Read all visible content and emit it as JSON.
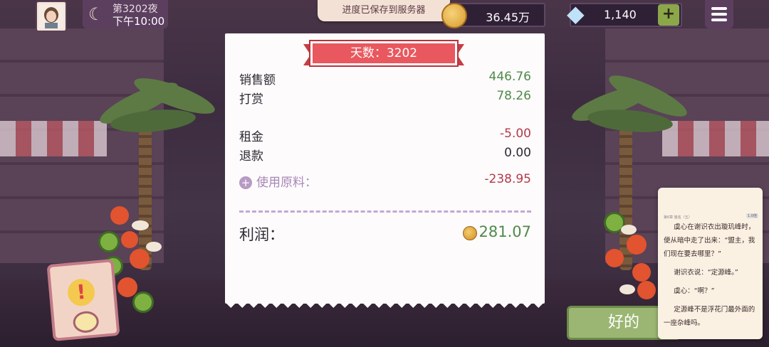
{
  "top_bar": {
    "night_label": "第3202夜",
    "time_label": "下午10:00",
    "save_toast": "进度已保存到服务器",
    "coins_value": "36.45万",
    "gems_value": "1,140",
    "add_gems_label": "+"
  },
  "receipt": {
    "banner": "天数：3202",
    "rows": [
      {
        "label": "销售额",
        "value": "446.76",
        "tone": "green"
      },
      {
        "label": "打赏",
        "value": "78.26",
        "tone": "green"
      },
      {
        "label": "租金",
        "value": "-5.00",
        "tone": "red"
      },
      {
        "label": "退款",
        "value": "0.00",
        "tone": "dark"
      },
      {
        "label": "使用原料：",
        "value": "-238.95",
        "tone": "red"
      }
    ],
    "profit_label": "利润：",
    "profit_value": "281.07",
    "ok_button": "好的"
  },
  "reader": {
    "header": "第6章  篇名（五）",
    "tag": "1.0倍",
    "lines": [
      "虞心在谢识衣出璇玑峰时，便从暗中走了出来：“盟主，我们现在要去哪里？”",
      "谢识衣说：“定源峰。”",
      "虞心：“啊？”",
      "定源峰不是浮花门最外面的一座杂峰吗。"
    ]
  },
  "icons": {
    "moon": "moon-icon",
    "coin": "coin-icon",
    "gem": "diamond-icon",
    "menu": "hamburger-menu-icon",
    "alert": "exclamation-alert-icon"
  },
  "colors": {
    "profit_green": "#4f8a4a",
    "loss_red": "#b23a4b",
    "banner_red": "#e8585e",
    "ok_green": "#9bb673"
  }
}
